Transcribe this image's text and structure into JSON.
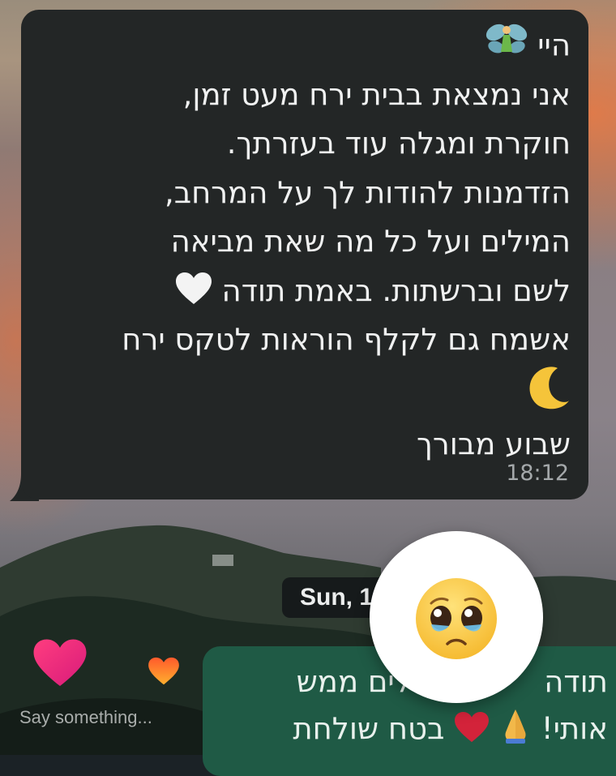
{
  "incoming_message": {
    "lines": [
      "היי",
      "אני נמצאת בבית ירח מעט זמן,",
      "חוקרת ומגלה עוד בעזרתך.",
      "הזדמנות להודות לך על המרחב,",
      "המילים ועל כל מה שאת מביאה",
      "לשם וברשתות. באמת תודה",
      "אשמח גם לקלף הוראות לטקס ירח",
      "שבוע מבורך"
    ],
    "emoji": {
      "fairy": "fairy-icon",
      "white_heart": "white-heart-icon",
      "crescent_moon": "crescent-moon-icon"
    },
    "time": "18:12"
  },
  "date_separator": "Sun, 1",
  "outgoing_message": {
    "line1_start": "תודה",
    "line1_end": "לים ממש",
    "line2_start": "אותי!",
    "line2_end": "בטח שולחת",
    "emoji": {
      "folded_hands": "folded-hands-icon",
      "red_heart": "red-heart-icon"
    }
  },
  "reaction": {
    "emoji": "pleading-face-icon"
  },
  "story_reply": {
    "placeholder": "Say something...",
    "hearts": [
      "gradient-heart-icon",
      "small-heart-icon"
    ]
  },
  "colors": {
    "incoming_bubble": "#232626",
    "outgoing_bubble": "#1f5a45",
    "timestamp": "#a4a8aa",
    "date_chip": "#161a1b"
  }
}
